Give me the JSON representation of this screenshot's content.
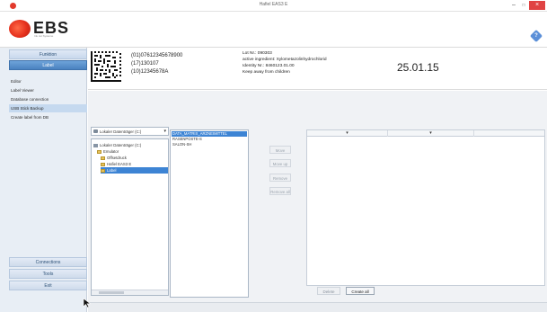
{
  "window": {
    "title": "Hafiel EAS3 E",
    "minimize_glyph": "–",
    "maximize_glyph": "□",
    "close_glyph": "×"
  },
  "header": {
    "logo_text": "EBS",
    "logo_subtitle": "Ink Jet Systeme",
    "help_icon": "diamond-help-icon",
    "help_glyph": "?",
    "accent_color": "#5b8fd8",
    "brand_color": "#e5301c"
  },
  "sidebar": {
    "tabs": [
      {
        "label": "Funktion",
        "active": false
      },
      {
        "label": "Label",
        "active": true
      }
    ],
    "items": [
      {
        "label": "Editor",
        "selected": false
      },
      {
        "label": "Label Viewer",
        "selected": false
      },
      {
        "label": "Database connection",
        "selected": false
      },
      {
        "label": "USB Stick Backup",
        "selected": true
      },
      {
        "label": "Create label from DB",
        "selected": false
      }
    ],
    "bottom": [
      {
        "label": "Connections"
      },
      {
        "label": "Tools"
      },
      {
        "label": "Exit"
      }
    ]
  },
  "preview": {
    "lines_left": [
      "(01)07612345678900",
      "(17)130107",
      "(10)12345678A"
    ],
    "lines_right": [
      "Lot Nr.: 090303",
      "active ingredient: Xylometazolinhydrochlorid",
      "Identity Nr.: 8460123.01.00",
      "Keep away from children"
    ],
    "date": "25.01.15"
  },
  "work": {
    "folder_select": "Lokaler Datenträger (C:)",
    "tree": [
      {
        "label": "Lokaler Datenträger (C:)",
        "type": "drive",
        "indent": 0,
        "selected": false
      },
      {
        "label": "Emulator",
        "type": "folder",
        "indent": 1,
        "selected": false
      },
      {
        "label": "Offsetdruck",
        "type": "folder",
        "indent": 2,
        "selected": false
      },
      {
        "label": "Hafiel EAS3 E",
        "type": "folder",
        "indent": 2,
        "selected": false
      },
      {
        "label": "Label",
        "type": "folder",
        "indent": 2,
        "selected": true
      }
    ],
    "files": [
      {
        "label": "DATA_MATRIX_ARZNEIMITTEL",
        "selected": true
      },
      {
        "label": "RASENPOSTE-S",
        "selected": false
      },
      {
        "label": "SALON-SH",
        "selected": false
      }
    ],
    "middle_buttons": [
      "Move",
      "Move up",
      "Remove",
      "Remove all"
    ],
    "right_columns": [
      "▾",
      "▾"
    ],
    "delete_label": "Delete",
    "create_label": "Create all"
  }
}
